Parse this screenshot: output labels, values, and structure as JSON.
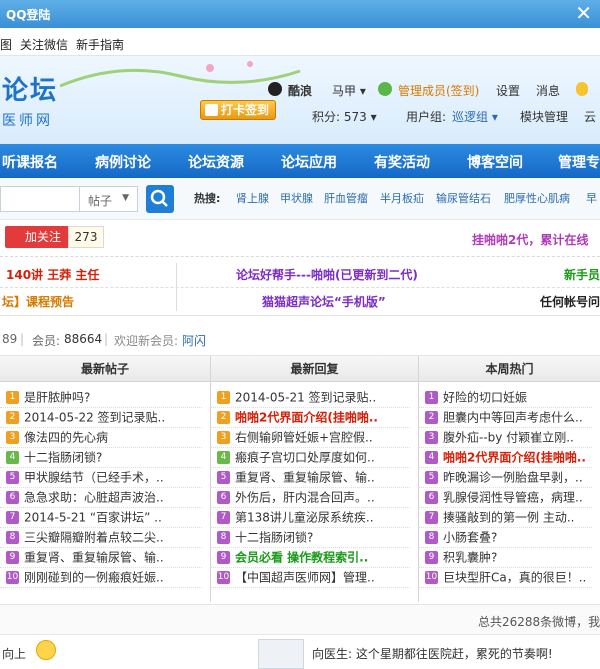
{
  "window": {
    "title": "QQ登陆",
    "close": "✕"
  },
  "menu": [
    "图",
    "关注微信",
    "新手指南"
  ],
  "header": {
    "logo_line1": "论坛",
    "logo_line2": "医师网",
    "sign_btn": "打卡签到",
    "username": "酷浪",
    "user_menu": "马甲 ▾",
    "member_status": "管理成员(签到)",
    "settings": "设置",
    "messages": "消息",
    "score": "积分: 573 ▾",
    "group_label": "用户组:",
    "group_value": "巡逻组 ▾",
    "module_mgmt": "模块管理",
    "cloud": "云"
  },
  "nav": [
    "听课报名",
    "病例讨论",
    "论坛资源",
    "论坛应用",
    "有奖活动",
    "博客空间",
    "管理专"
  ],
  "search": {
    "placeholder": "",
    "select": "帖子",
    "hot_label": "热搜:",
    "hot": [
      "肾上腺",
      "甲状腺",
      "肝血管瘤",
      "半月板疝",
      "输尿管结石",
      "肥厚性心肌病",
      "早"
    ]
  },
  "weibo": {
    "follow": "加关注",
    "count": "273",
    "promo": "挂啪啪2代，累计在线"
  },
  "announcements": [
    {
      "text": "140讲 王莽 主任",
      "color": "#d81e06"
    },
    {
      "text": "论坛好帮手---啪啪(已更新到二代)",
      "color": "#7b2cc9"
    },
    {
      "text": "新手员",
      "color": "#1a9b1a"
    },
    {
      "text": "坛】课程预告",
      "color": "#d87a00"
    },
    {
      "text": "猫猫超声论坛“手机版”",
      "color": "#7b2cc9"
    },
    {
      "text": "任何帐号问",
      "color": "#222"
    }
  ],
  "stats": {
    "posts": "89",
    "members_label": "会员:",
    "members": "88664",
    "welcome_label": "欢迎新会员:",
    "newest": "阿闪"
  },
  "panels": [
    {
      "title": "最新帖子",
      "items": [
        {
          "n": "1",
          "text": "是肝脓肿吗?",
          "color": "#333",
          "bg": "#f0a020"
        },
        {
          "n": "2",
          "text": "2014-05-22 签到记录贴..",
          "color": "#333",
          "bg": "#f0a020"
        },
        {
          "n": "3",
          "text": "像法四的先心病",
          "color": "#333",
          "bg": "#f0a020"
        },
        {
          "n": "4",
          "text": "十二指肠闭锁?",
          "color": "#333",
          "bg": "#6bb84a"
        },
        {
          "n": "5",
          "text": "甲状腺结节（已经手术，..",
          "color": "#333",
          "bg": "#b05ac8"
        },
        {
          "n": "6",
          "text": "急急求助：心脏超声波治..",
          "color": "#333",
          "bg": "#b05ac8"
        },
        {
          "n": "7",
          "text": "2014-5-21 “百家讲坛” ..",
          "color": "#333",
          "bg": "#b05ac8"
        },
        {
          "n": "8",
          "text": "三尖瓣隔瓣附着点较二尖..",
          "color": "#333",
          "bg": "#b05ac8"
        },
        {
          "n": "9",
          "text": "重复肾、重复输尿管、输..",
          "color": "#333",
          "bg": "#b05ac8"
        },
        {
          "n": "10",
          "text": "刚刚碰到的一例瘢痕妊娠..",
          "color": "#333",
          "bg": "#b05ac8"
        }
      ]
    },
    {
      "title": "最新回复",
      "items": [
        {
          "n": "1",
          "text": "2014-05-21 签到记录贴..",
          "color": "#333",
          "bg": "#f0a020"
        },
        {
          "n": "2",
          "text": "啪啪2代界面介绍(挂啪啪..",
          "color": "#d81e06",
          "bg": "#f0a020"
        },
        {
          "n": "3",
          "text": "右侧输卵管妊娠+宫腔假..",
          "color": "#333",
          "bg": "#f0a020"
        },
        {
          "n": "4",
          "text": "瘢痕子宫切口处厚度如何..",
          "color": "#333",
          "bg": "#6bb84a"
        },
        {
          "n": "5",
          "text": "重复肾、重复输尿管、输..",
          "color": "#333",
          "bg": "#b05ac8"
        },
        {
          "n": "6",
          "text": "外伤后，肝内混合回声。..",
          "color": "#333",
          "bg": "#b05ac8"
        },
        {
          "n": "7",
          "text": "第138讲儿童泌尿系统疾..",
          "color": "#333",
          "bg": "#b05ac8"
        },
        {
          "n": "8",
          "text": "十二指肠闭锁?",
          "color": "#333",
          "bg": "#b05ac8"
        },
        {
          "n": "9",
          "text": "会员必看  操作教程索引..",
          "color": "#1a9b1a",
          "bg": "#b05ac8"
        },
        {
          "n": "10",
          "text": "【中国超声医师网】管理..",
          "color": "#333",
          "bg": "#b05ac8"
        }
      ]
    },
    {
      "title": "本周热门",
      "items": [
        {
          "n": "1",
          "text": "好险的切口妊娠",
          "color": "#333",
          "bg": "#b05ac8"
        },
        {
          "n": "2",
          "text": "胆囊内中等回声考虑什么..",
          "color": "#333",
          "bg": "#b05ac8"
        },
        {
          "n": "3",
          "text": "腹外疝--by 付颖崔立刚..",
          "color": "#333",
          "bg": "#b05ac8"
        },
        {
          "n": "4",
          "text": "啪啪2代界面介绍(挂啪啪..",
          "color": "#d81e06",
          "bg": "#b05ac8"
        },
        {
          "n": "5",
          "text": "昨晚漏诊一例胎盘早剥，..",
          "color": "#333",
          "bg": "#b05ac8"
        },
        {
          "n": "6",
          "text": "乳腺侵润性导管癌，病理..",
          "color": "#333",
          "bg": "#b05ac8"
        },
        {
          "n": "7",
          "text": "揍骚敲到的第一例 主动..",
          "color": "#333",
          "bg": "#b05ac8"
        },
        {
          "n": "8",
          "text": "小肠套叠?",
          "color": "#333",
          "bg": "#b05ac8"
        },
        {
          "n": "9",
          "text": "积乳囊肿?",
          "color": "#333",
          "bg": "#b05ac8"
        },
        {
          "n": "10",
          "text": "巨块型肝Ca，真的很巨！..",
          "color": "#333",
          "bg": "#b05ac8"
        }
      ]
    }
  ],
  "total": "总共26288条微博，我有",
  "bottom": {
    "left": "向上",
    "post": "向医生: 这个星期都往医院赶，累死的节奏啊!"
  }
}
